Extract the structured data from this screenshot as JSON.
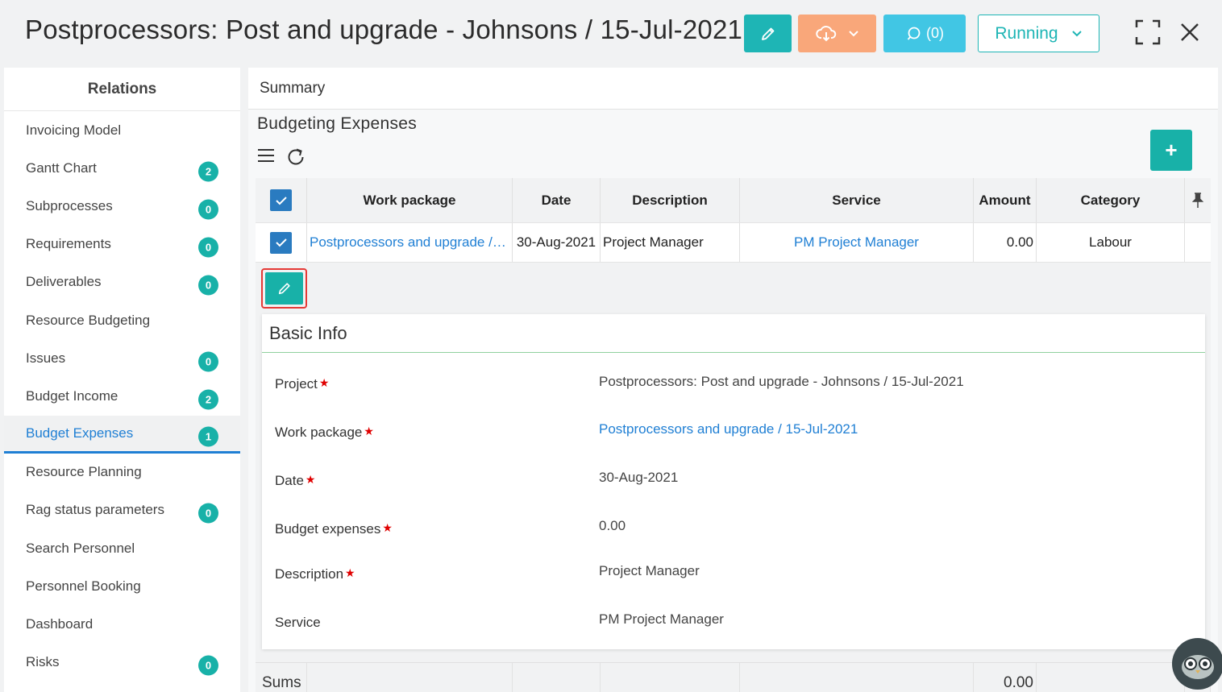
{
  "header": {
    "title": "Postprocessors: Post and upgrade - Johnsons / 15-Jul-2021",
    "comments_label": "(0)",
    "status_label": "Running"
  },
  "sidebar": {
    "title": "Relations",
    "items": [
      {
        "label": "Invoicing Model",
        "badge": ""
      },
      {
        "label": "Gantt Chart",
        "badge": "2"
      },
      {
        "label": "Subprocesses",
        "badge": "0"
      },
      {
        "label": "Requirements",
        "badge": "0"
      },
      {
        "label": "Deliverables",
        "badge": "0"
      },
      {
        "label": "Resource Budgeting",
        "badge": ""
      },
      {
        "label": "Issues",
        "badge": "0"
      },
      {
        "label": "Budget Income",
        "badge": "2"
      },
      {
        "label": "Budget Expenses",
        "badge": "1"
      },
      {
        "label": "Resource Planning",
        "badge": ""
      },
      {
        "label": "Rag status parameters",
        "badge": "0"
      },
      {
        "label": "Search Personnel",
        "badge": ""
      },
      {
        "label": "Personnel Booking",
        "badge": ""
      },
      {
        "label": "Dashboard",
        "badge": ""
      },
      {
        "label": "Risks",
        "badge": "0"
      }
    ],
    "active_index": 8
  },
  "main": {
    "tab": "Summary",
    "section_title": "Budgeting Expenses",
    "add_label": "+",
    "table": {
      "columns": [
        "Work package",
        "Date",
        "Description",
        "Service",
        "Amount",
        "Category"
      ],
      "rows": [
        {
          "work_package": "Postprocessors and upgrade / 15-Jul-2021",
          "date": "30-Aug-2021",
          "description": "Project Manager",
          "service": "PM Project Manager",
          "amount": "0.00",
          "category": "Labour"
        }
      ],
      "sums_label": "Sums",
      "sums_amount": "0.00"
    },
    "detail": {
      "title": "Basic Info",
      "fields": [
        {
          "label": "Project",
          "value": "Postprocessors: Post and upgrade - Johnsons / 15-Jul-2021",
          "required": "★"
        },
        {
          "label": "Work package",
          "value": "Postprocessors and upgrade / 15-Jul-2021",
          "required": "★"
        },
        {
          "label": "Date",
          "value": "30-Aug-2021",
          "required": "★"
        },
        {
          "label": "Budget expenses",
          "value": "0.00",
          "required": "★"
        },
        {
          "label": "Description",
          "value": "Project Manager",
          "required": "★"
        },
        {
          "label": "Service",
          "value": "PM Project Manager",
          "required": ""
        }
      ]
    }
  },
  "colors": {
    "teal": "#18b1a8",
    "orange": "#f9a77a",
    "cyan": "#41c6e4",
    "link": "#1f7fd4",
    "required": "#e00000"
  }
}
